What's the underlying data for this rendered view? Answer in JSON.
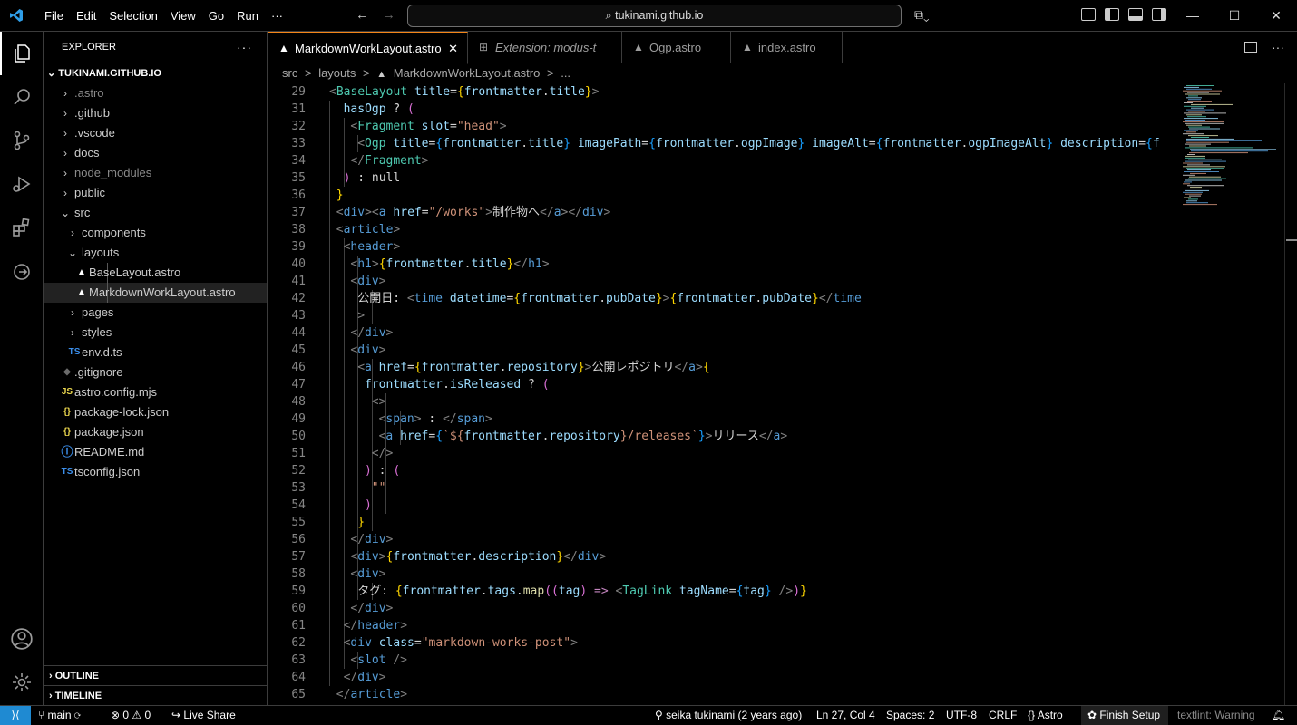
{
  "titlebar": {
    "menu": [
      "File",
      "Edit",
      "Selection",
      "View",
      "Go",
      "Run",
      "···"
    ],
    "search": "tukinami.github.io",
    "window_controls": [
      "—",
      "☐",
      "✕"
    ]
  },
  "explorer": {
    "header": "EXPLORER",
    "more": "···",
    "root": "TUKINAMI.GITHUB.IO",
    "items": [
      {
        "name": ".astro",
        "kind": "folder",
        "dim": true
      },
      {
        "name": ".github",
        "kind": "folder"
      },
      {
        "name": ".vscode",
        "kind": "folder"
      },
      {
        "name": "docs",
        "kind": "folder"
      },
      {
        "name": "node_modules",
        "kind": "folder",
        "dim": true
      },
      {
        "name": "public",
        "kind": "folder"
      },
      {
        "name": "src",
        "kind": "folder-open"
      },
      {
        "name": "components",
        "kind": "folder"
      },
      {
        "name": "layouts",
        "kind": "folder-open"
      },
      {
        "name": "BaseLayout.astro",
        "kind": "astro"
      },
      {
        "name": "MarkdownWorkLayout.astro",
        "kind": "astro",
        "selected": true
      },
      {
        "name": "pages",
        "kind": "folder"
      },
      {
        "name": "styles",
        "kind": "folder"
      },
      {
        "name": "env.d.ts",
        "kind": "ts",
        "icon_text": "TS"
      },
      {
        "name": ".gitignore",
        "kind": "git"
      },
      {
        "name": "astro.config.mjs",
        "kind": "js",
        "icon_text": "JS"
      },
      {
        "name": "package-lock.json",
        "kind": "json",
        "icon_text": "{}"
      },
      {
        "name": "package.json",
        "kind": "json",
        "icon_text": "{}"
      },
      {
        "name": "README.md",
        "kind": "info",
        "icon_text": "i"
      },
      {
        "name": "tsconfig.json",
        "kind": "tsconfig",
        "icon_text": "TS"
      }
    ],
    "outline": "OUTLINE",
    "timeline": "TIMELINE"
  },
  "tabs": [
    {
      "label": "MarkdownWorkLayout.astro",
      "active": true,
      "close": "✕"
    },
    {
      "label": "Extension: modus-t",
      "italic": true
    },
    {
      "label": "Ogp.astro"
    },
    {
      "label": "index.astro"
    }
  ],
  "breadcrumb": [
    "src",
    ">",
    "layouts",
    ">",
    "MarkdownWorkLayout.astro",
    ">",
    "..."
  ],
  "code": {
    "line_numbers": [
      "29",
      "31",
      "32",
      "33",
      "34",
      "35",
      "36",
      "37",
      "38",
      "39",
      "40",
      "41",
      "42",
      "43",
      "44",
      "45",
      "46",
      "47",
      "48",
      "49",
      "50",
      "51",
      "52",
      "53",
      "54",
      "55",
      "56",
      "57",
      "58",
      "59",
      "60",
      "61",
      "62",
      "63",
      "64",
      "65"
    ]
  },
  "status": {
    "branch": "main",
    "problems": "⊗ 0 ⚠ 0",
    "live_share": "Live Share",
    "blame": "seika tukinami (2 years ago)",
    "position": "Ln 27, Col 4",
    "spaces": "Spaces: 2",
    "encoding": "UTF-8",
    "eol": "CRLF",
    "language": "Astro",
    "setup": "Finish Setup",
    "textlint": "textlint: Warning"
  },
  "colors": {
    "accent_tab": "#f38518",
    "remote": "#1f8ad2",
    "astro_icon": "#ff5d01"
  }
}
